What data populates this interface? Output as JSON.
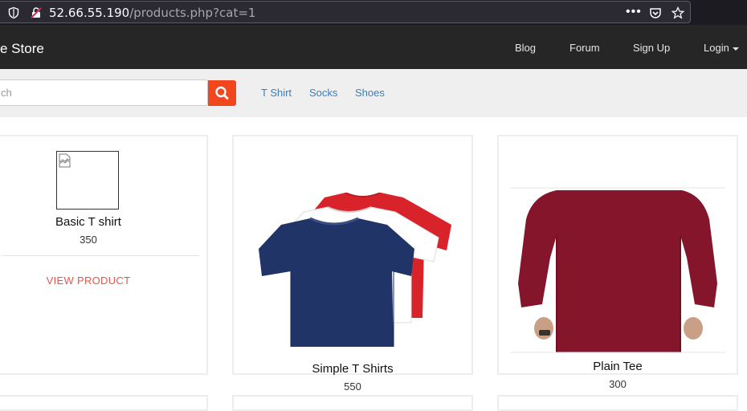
{
  "browser": {
    "url_host": "52.66.55.190",
    "url_path": "/products.php?cat=1",
    "more_icon": "•••"
  },
  "nav": {
    "brand": "e Store",
    "links": [
      "Blog",
      "Forum",
      "Sign Up",
      "Login"
    ]
  },
  "search": {
    "placeholder": "ch",
    "categories": [
      "T Shirt",
      "Socks",
      "Shoes"
    ]
  },
  "products": [
    {
      "name": "Basic T shirt",
      "price": "350",
      "action": "VIEW PRODUCT"
    },
    {
      "name": "Simple T Shirts",
      "price": "550"
    },
    {
      "name": "Plain Tee",
      "price": "300"
    }
  ],
  "colors": {
    "navbar": "#262626",
    "search_button": "#f2461f",
    "category_link": "#3c7dbf",
    "view_product": "#e4564b"
  }
}
